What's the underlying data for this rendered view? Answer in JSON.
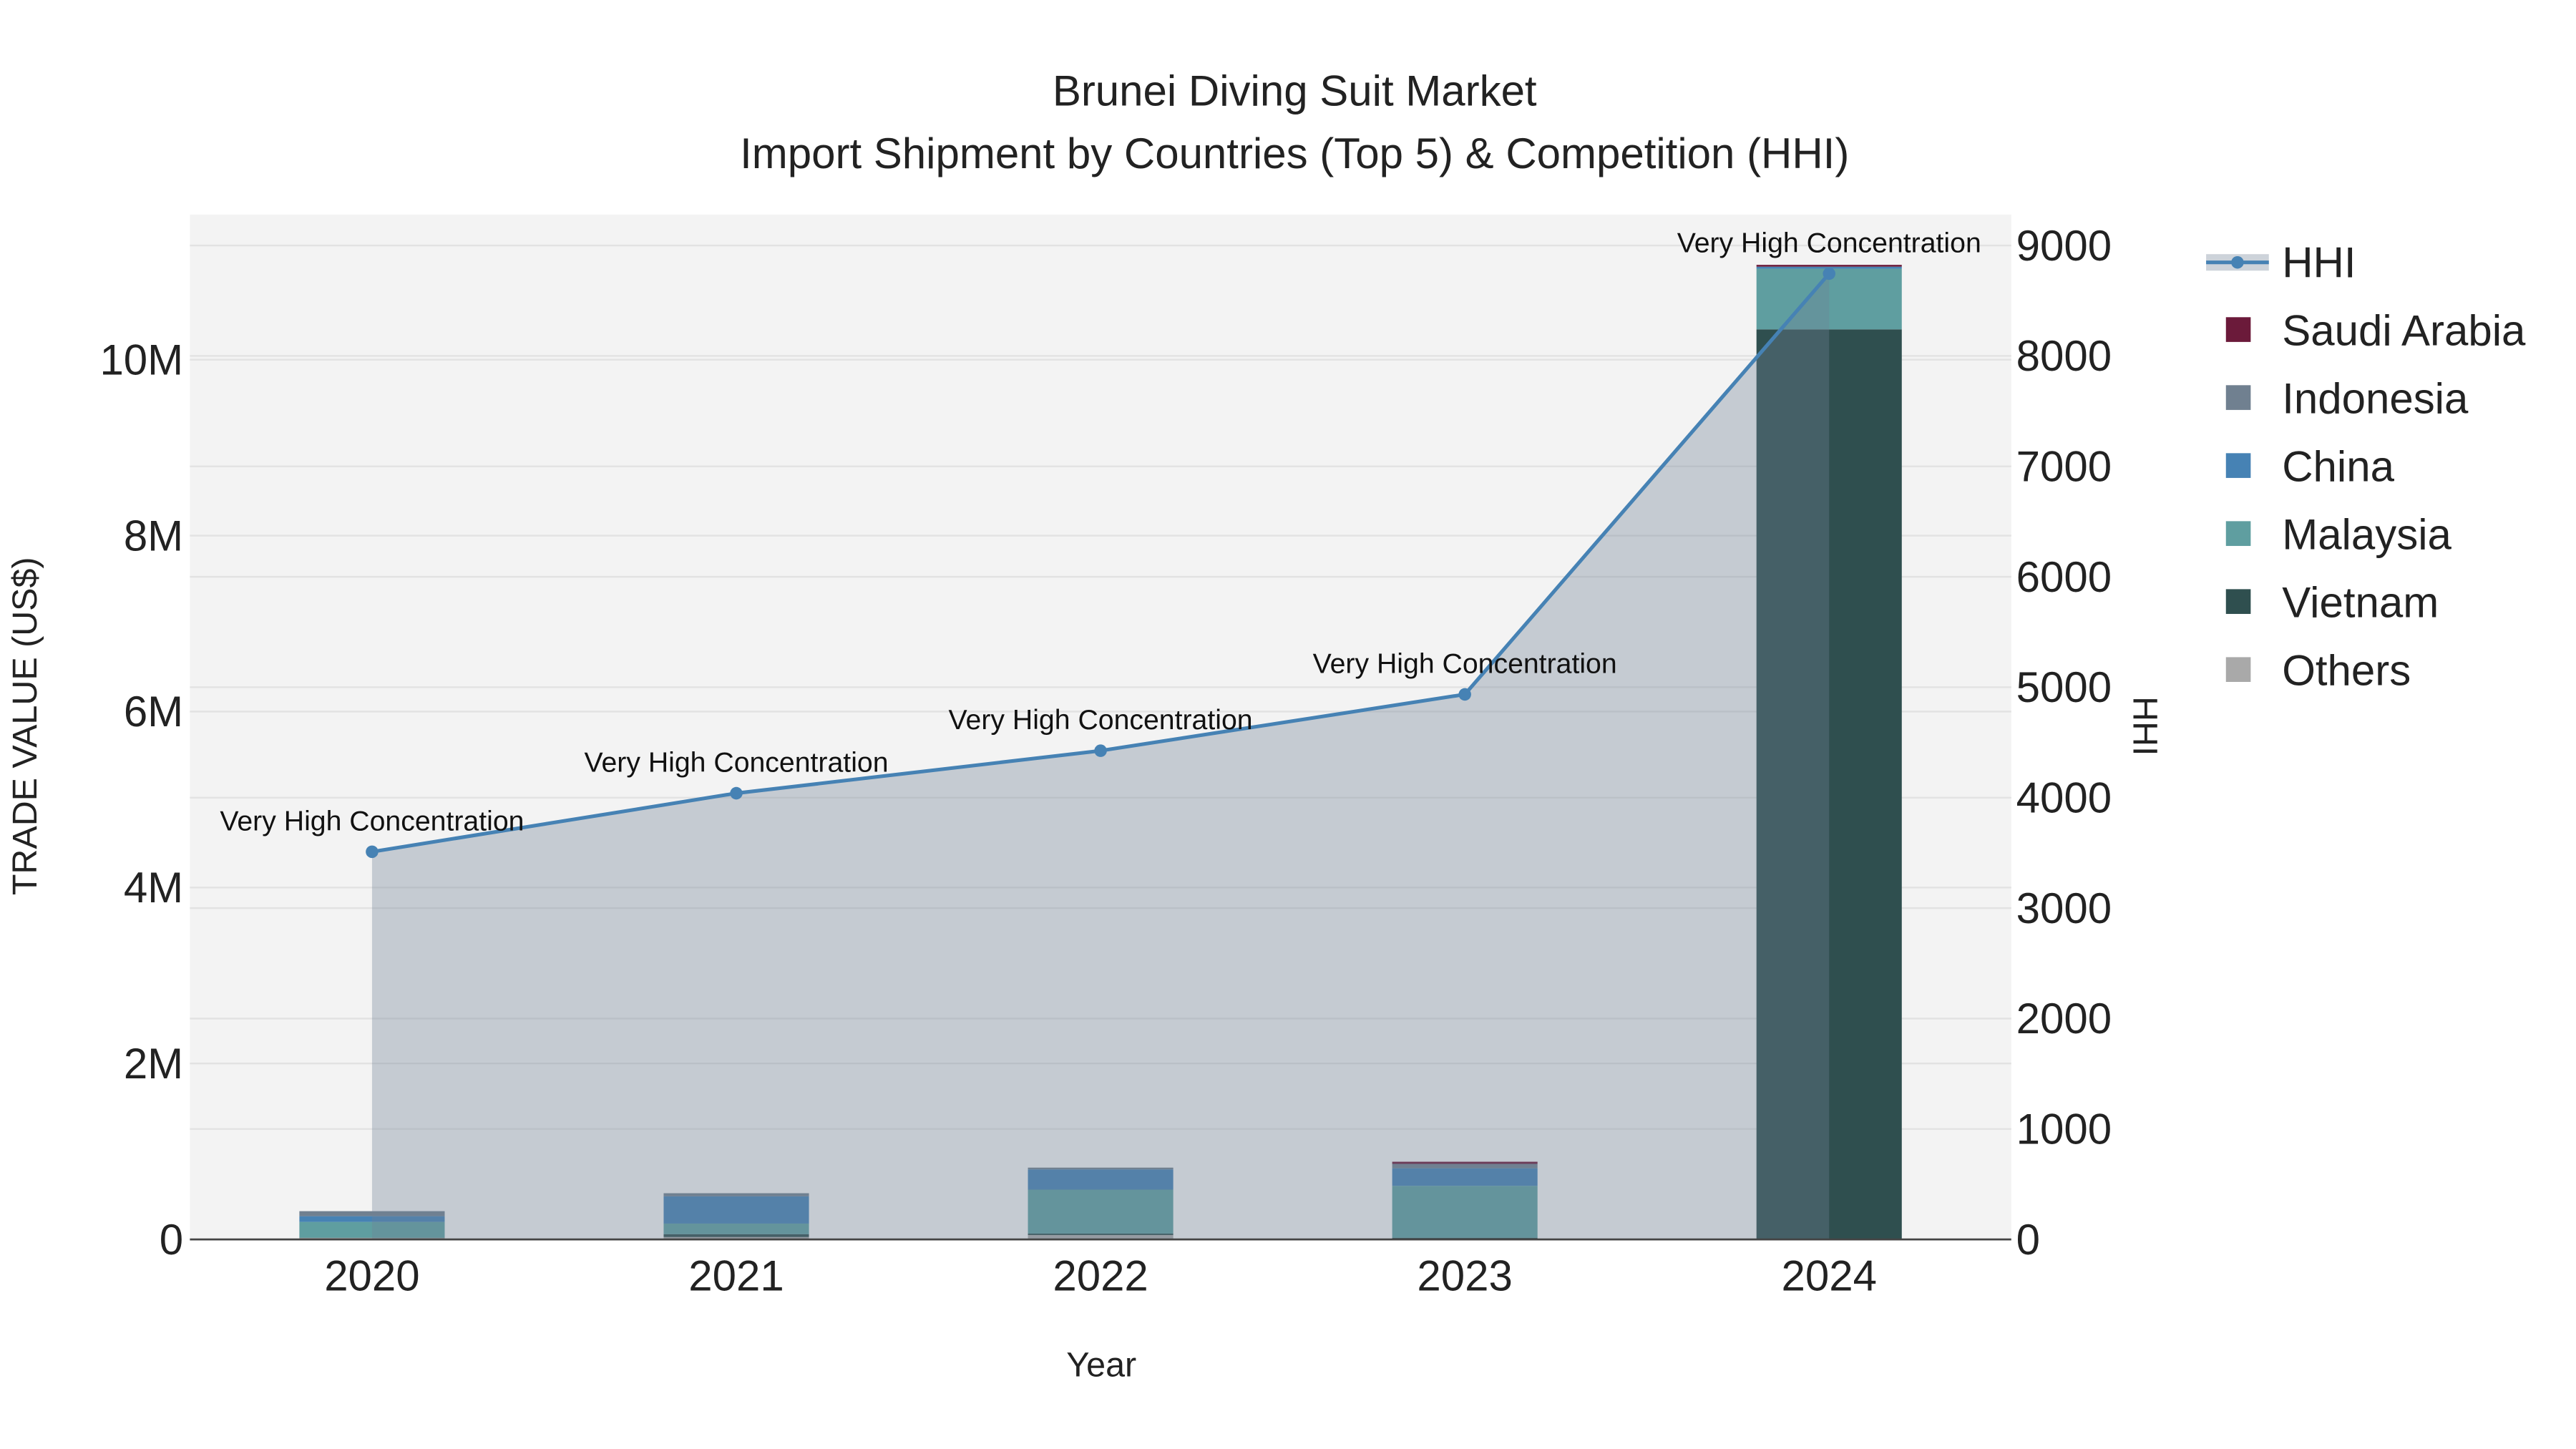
{
  "chart_data": {
    "type": "bar",
    "title": "Brunei Diving Suit Market",
    "subtitle": "Import Shipment by Countries (Top 5) & Competition (HHI)",
    "xlabel": "Year",
    "ylabel": "TRADE VALUE (US$)",
    "y2label": "HHI",
    "categories": [
      "2020",
      "2021",
      "2022",
      "2023",
      "2024"
    ],
    "ylim": [
      0,
      11650000
    ],
    "y2lim": [
      0,
      9280
    ],
    "yticks": [
      0,
      2000000,
      4000000,
      6000000,
      8000000,
      10000000
    ],
    "ytick_labels": [
      "0",
      "2M",
      "4M",
      "6M",
      "8M",
      "10M"
    ],
    "y2ticks": [
      0,
      1000,
      2000,
      3000,
      4000,
      5000,
      6000,
      7000,
      8000,
      9000
    ],
    "y2tick_labels": [
      "0",
      "1000",
      "2000",
      "3000",
      "4000",
      "5000",
      "6000",
      "7000",
      "8000",
      "9000"
    ],
    "stacked": true,
    "series": [
      {
        "name": "Others",
        "color": "#a9a9a9",
        "values": [
          16000,
          27000,
          50000,
          3000,
          5000
        ]
      },
      {
        "name": "Vietnam",
        "color": "#2f4f4f",
        "values": [
          3000,
          33000,
          16000,
          16000,
          10340000
        ]
      },
      {
        "name": "Malaysia",
        "color": "#5f9ea0",
        "values": [
          180000,
          120000,
          500000,
          590000,
          690000
        ]
      },
      {
        "name": "China",
        "color": "#4682b4",
        "values": [
          65000,
          310000,
          230000,
          200000,
          20000
        ]
      },
      {
        "name": "Indonesia",
        "color": "#708090",
        "values": [
          57000,
          35000,
          20000,
          50000,
          3000
        ]
      },
      {
        "name": "Saudi Arabia",
        "color": "#6b1a3a",
        "values": [
          0,
          0,
          0,
          24000,
          20000
        ]
      }
    ],
    "hhi": {
      "name": "HHI",
      "color": "#4682b4",
      "values": [
        3510,
        4040,
        4425,
        4935,
        8745
      ],
      "annotations": [
        "Very High Concentration",
        "Very High Concentration",
        "Very High Concentration",
        "Very High Concentration",
        "Very High Concentration"
      ]
    },
    "legend_order": [
      "HHI",
      "Saudi Arabia",
      "Indonesia",
      "China",
      "Malaysia",
      "Vietnam",
      "Others"
    ],
    "legend_placement": "right",
    "grid": true
  }
}
